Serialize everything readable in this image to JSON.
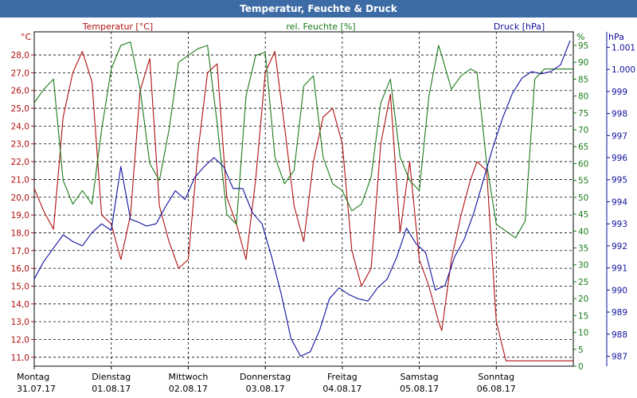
{
  "window": {
    "title": "Temperatur, Feuchte & Druck"
  },
  "colors": {
    "temperature": "#b01010",
    "humidity": "#1a7a1a",
    "pressure": "#1010a0",
    "title_bar": "#3c6ba6"
  },
  "chart_data": {
    "type": "line",
    "title": "Temperatur, Feuchte & Druck",
    "grid": true,
    "x": {
      "type": "date",
      "range": [
        "2017-07-31",
        "2017-08-07"
      ]
    },
    "x_ticks": [
      {
        "day": "Montag",
        "date": "31.07.17"
      },
      {
        "day": "Dienstag",
        "date": "01.08.17"
      },
      {
        "day": "Mittwoch",
        "date": "02.08.17"
      },
      {
        "day": "Donnerstag",
        "date": "03.08.17"
      },
      {
        "day": "Freitag",
        "date": "04.08.17"
      },
      {
        "day": "Samstag",
        "date": "05.08.17"
      },
      {
        "day": "Sonntag",
        "date": "06.08.17"
      }
    ],
    "axes": {
      "temperature": {
        "label": "Temperatur [°C]",
        "unit": "°C",
        "range": [
          10.5,
          29.3
        ],
        "ticks": [
          11.0,
          12.0,
          13.0,
          14.0,
          15.0,
          16.0,
          17.0,
          18.0,
          19.0,
          20.0,
          21.0,
          22.0,
          23.0,
          24.0,
          25.0,
          26.0,
          27.0,
          28.0
        ]
      },
      "humidity": {
        "label": "rel. Feuchte [%]",
        "unit": "%",
        "range": [
          0,
          99
        ],
        "ticks": [
          0,
          5,
          10,
          15,
          20,
          25,
          30,
          35,
          40,
          45,
          50,
          55,
          60,
          65,
          70,
          75,
          80,
          85,
          90,
          95
        ]
      },
      "pressure": {
        "label": "Druck [hPa]",
        "unit": "hPa",
        "range": [
          986.55,
          1001.7
        ],
        "ticks": [
          "987",
          "988",
          "989",
          "990",
          "991",
          "992",
          "993",
          "994",
          "995",
          "996",
          "997",
          "998",
          "999",
          "1.000",
          "1.001"
        ]
      }
    },
    "series": [
      {
        "name": "Temperatur [°C]",
        "axis": "temperature",
        "color": "#b01010",
        "x_hours": [
          0,
          3,
          6,
          9,
          12,
          15,
          18,
          21,
          24,
          27,
          30,
          33,
          36,
          39,
          42,
          45,
          48,
          51,
          54,
          57,
          60,
          63,
          66,
          69,
          72,
          75,
          78,
          81,
          84,
          87,
          90,
          93,
          96,
          99,
          102,
          105,
          108,
          111,
          114,
          117,
          120,
          123,
          126,
          127,
          130,
          133,
          136,
          138,
          141,
          144,
          147,
          150,
          153,
          156,
          159,
          162,
          165,
          168
        ],
        "values": [
          20.5,
          19.2,
          18.2,
          24.5,
          27.0,
          28.2,
          26.5,
          19.0,
          18.5,
          16.5,
          19.0,
          26.0,
          27.8,
          19.5,
          17.5,
          16.0,
          16.5,
          22.5,
          27.0,
          27.5,
          20.0,
          18.5,
          16.5,
          21.0,
          27.0,
          28.2,
          24.0,
          19.5,
          17.5,
          22.0,
          24.5,
          25.0,
          23.0,
          17.0,
          15.0,
          16.0,
          23.0,
          25.8,
          18.0,
          22.0,
          16.5,
          15.0,
          13.0,
          12.5,
          16.5,
          19.0,
          21.0,
          22.0,
          21.5,
          13.0,
          10.8,
          10.8,
          10.8,
          10.8,
          10.8,
          10.8,
          10.8,
          10.8
        ]
      },
      {
        "name": "rel. Feuchte [%]",
        "axis": "humidity",
        "color": "#1a7a1a",
        "x_hours": [
          0,
          3,
          6,
          9,
          12,
          15,
          18,
          21,
          24,
          27,
          30,
          33,
          36,
          39,
          42,
          45,
          48,
          51,
          54,
          57,
          60,
          63,
          66,
          69,
          72,
          75,
          78,
          81,
          84,
          87,
          90,
          93,
          96,
          99,
          102,
          105,
          108,
          111,
          114,
          117,
          120,
          123,
          126,
          127,
          130,
          133,
          136,
          138,
          141,
          144,
          147,
          150,
          153,
          156,
          159,
          162,
          165,
          168
        ],
        "values": [
          78,
          82,
          85,
          55,
          48,
          52,
          48,
          70,
          88,
          95,
          96,
          82,
          60,
          55,
          70,
          90,
          92,
          94,
          95,
          72,
          45,
          42,
          80,
          92,
          93,
          62,
          54,
          58,
          83,
          86,
          62,
          54,
          52,
          46,
          48,
          56,
          78,
          85,
          62,
          55,
          52,
          80,
          95,
          92,
          82,
          86,
          88,
          87,
          60,
          42,
          40,
          38,
          43,
          85,
          88,
          88,
          88,
          88
        ]
      },
      {
        "name": "Druck [hPa]",
        "axis": "pressure",
        "color": "#1010a0",
        "x_hours": [
          0,
          3,
          6,
          9,
          12,
          15,
          18,
          21,
          24,
          27,
          30,
          32,
          35,
          38,
          41,
          44,
          47,
          50,
          53,
          56,
          59,
          62,
          65,
          68,
          71,
          74,
          77,
          80,
          83,
          86,
          89,
          92,
          95,
          98,
          101,
          104,
          107,
          110,
          113,
          116,
          119,
          122,
          125,
          128,
          131,
          134,
          137,
          140,
          143,
          146,
          149,
          152,
          155,
          158,
          161,
          164,
          167
        ],
        "values": [
          990.5,
          991.3,
          991.9,
          992.5,
          992.2,
          992.0,
          992.6,
          993.0,
          992.7,
          995.6,
          993.2,
          993.1,
          992.9,
          993.0,
          993.8,
          994.5,
          994.1,
          995.1,
          995.6,
          996.0,
          995.6,
          994.6,
          994.6,
          993.5,
          993.0,
          991.5,
          989.8,
          987.8,
          987.0,
          987.2,
          988.2,
          989.6,
          990.1,
          989.8,
          989.6,
          989.5,
          990.1,
          990.5,
          991.5,
          992.8,
          992.1,
          991.7,
          990.0,
          990.2,
          991.5,
          992.3,
          993.5,
          995.0,
          996.5,
          997.8,
          998.9,
          999.6,
          999.9,
          999.8,
          999.9,
          1000.2,
          1001.3
        ]
      }
    ]
  }
}
